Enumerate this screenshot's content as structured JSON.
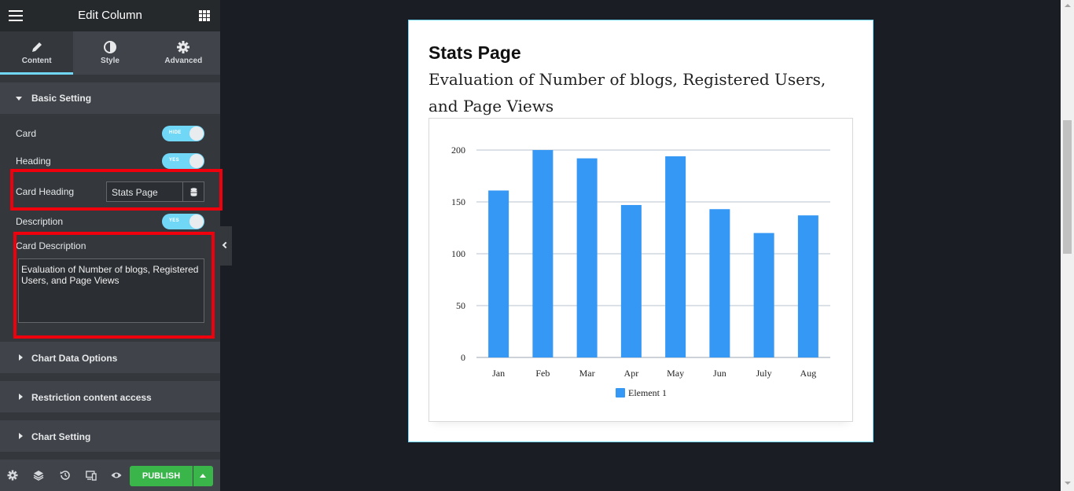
{
  "panel": {
    "title": "Edit Column",
    "tabs": [
      {
        "label": "Content",
        "icon": "pencil-icon",
        "active": true
      },
      {
        "label": "Style",
        "icon": "half-circle-icon",
        "active": false
      },
      {
        "label": "Advanced",
        "icon": "gear-icon",
        "active": false
      }
    ],
    "basic_section": {
      "label": "Basic Setting",
      "card_label": "Card",
      "card_toggle": "HIDE",
      "heading_label": "Heading",
      "heading_toggle": "YES",
      "card_heading_label": "Card Heading",
      "card_heading_value": "Stats Page",
      "description_label": "Description",
      "description_toggle": "YES",
      "card_description_label": "Card Description",
      "card_description_value": "Evaluation of Number of blogs, Registered Users, and Page Views"
    },
    "sections": [
      "Chart Data Options",
      "Restriction content access",
      "Chart Setting"
    ],
    "publish_label": "PUBLISH",
    "accent_color": "#71d7f7",
    "publish_color": "#39b54a",
    "highlight_color": "#f0000c"
  },
  "card": {
    "heading": "Stats Page",
    "description": "Evaluation of Number of blogs, Registered Users, and Page Views"
  },
  "chart_data": {
    "type": "bar",
    "categories": [
      "Jan",
      "Feb",
      "Mar",
      "Apr",
      "May",
      "Jun",
      "July",
      "Aug"
    ],
    "series": [
      {
        "name": "Element 1",
        "values": [
          161,
          200,
          192,
          147,
          194,
          143,
          120,
          137
        ],
        "color": "#3598f5"
      }
    ],
    "ylim": [
      0,
      200
    ],
    "yticks": [
      0,
      50,
      100,
      150,
      200
    ],
    "grid": true,
    "legend_position": "bottom"
  }
}
